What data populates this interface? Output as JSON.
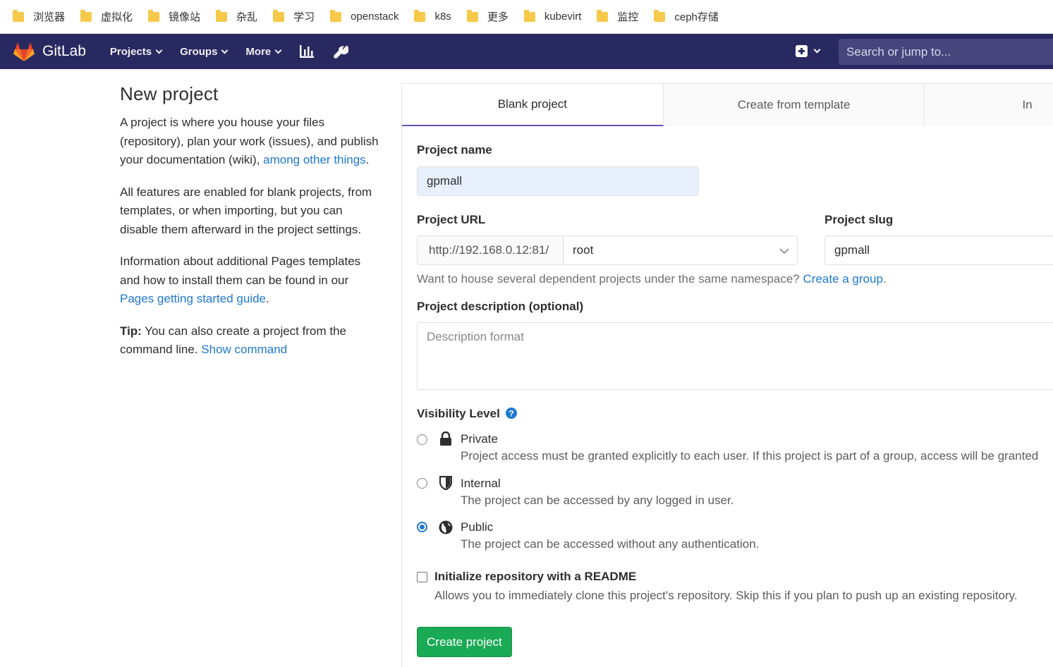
{
  "bookmarks": [
    "浏览器",
    "虚拟化",
    "镜像站",
    "杂乱",
    "学习",
    "openstack",
    "k8s",
    "更多",
    "kubevirt",
    "监控",
    "ceph存储"
  ],
  "navbar": {
    "brand": "GitLab",
    "items": [
      "Projects",
      "Groups",
      "More"
    ],
    "search_placeholder": "Search or jump to..."
  },
  "sidebar": {
    "title": "New project",
    "p1_text": "A project is where you house your files (repository), plan your work (issues), and publish your documentation (wiki), ",
    "p1_link": "among other things",
    "p1_end": ".",
    "p2_text": "All features are enabled for blank projects, from templates, or when importing, but you can disable them afterward in the project settings.",
    "p3_text": "Information about additional Pages templates and how to install them can be found in our ",
    "p3_link": "Pages getting started guide",
    "p3_end": ".",
    "tip_label": "Tip:",
    "tip_text": " You can also create a project from the command line. ",
    "tip_link": "Show command"
  },
  "tabs": [
    "Blank project",
    "Create from template",
    "In"
  ],
  "form": {
    "project_name_label": "Project name",
    "project_name_value": "gpmall",
    "project_url_label": "Project URL",
    "url_prefix": "http://192.168.0.12:81/",
    "namespace": "root",
    "slug_label": "Project slug",
    "slug_value": "gpmall",
    "namespace_hint": "Want to house several dependent projects under the same namespace? ",
    "namespace_hint_link": "Create a group",
    "namespace_hint_end": ".",
    "description_label": "Project description (optional)",
    "description_placeholder": "Description format",
    "visibility_label": "Visibility Level",
    "visibility_options": [
      {
        "title": "Private",
        "desc": "Project access must be granted explicitly to each user. If this project is part of a group, access will be granted",
        "checked": false
      },
      {
        "title": "Internal",
        "desc": "The project can be accessed by any logged in user.",
        "checked": false
      },
      {
        "title": "Public",
        "desc": "The project can be accessed without any authentication.",
        "checked": true
      }
    ],
    "readme_label": "Initialize repository with a README",
    "readme_desc": "Allows you to immediately clone this project's repository. Skip this if you plan to push up an existing repository.",
    "submit_label": "Create project"
  },
  "colors": {
    "navbar": "#292961",
    "link": "#1f78d1",
    "create_button": "#1aaa55",
    "active_tab_border": "#6b4fbb",
    "name_input_bg": "#e8f0fe"
  }
}
